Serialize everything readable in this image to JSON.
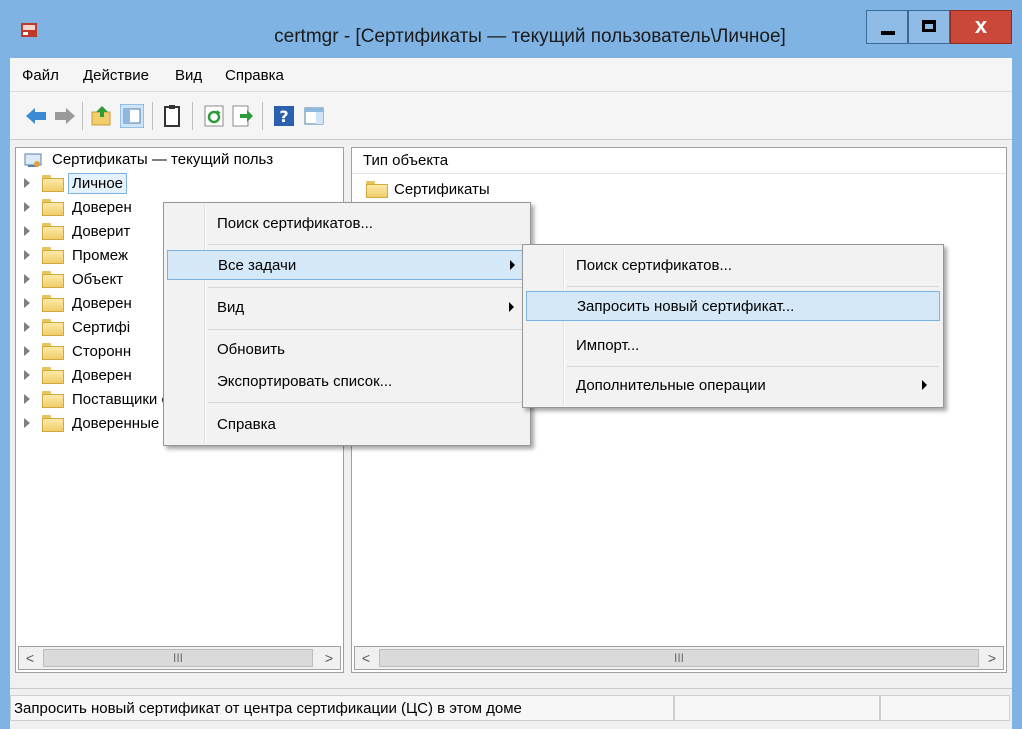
{
  "window": {
    "title": "certmgr - [Сертификаты — текущий пользователь\\Личное]",
    "close_glyph": "x"
  },
  "menubar": {
    "items": [
      "Файл",
      "Действие",
      "Вид",
      "Справка"
    ]
  },
  "toolbar": {
    "buttons": [
      "back-icon",
      "forward-icon",
      "up-folder-icon",
      "show-hide-tree-icon",
      "properties-icon",
      "refresh-icon",
      "export-list-icon",
      "help-icon",
      "action-pane-icon"
    ]
  },
  "tree": {
    "root_label": "Сертификаты — текущий польз",
    "items": [
      {
        "label": "Личное",
        "selected": true
      },
      {
        "label": "Доверен"
      },
      {
        "label": "Доверит"
      },
      {
        "label": "Промеж"
      },
      {
        "label": "Объект"
      },
      {
        "label": "Доверен"
      },
      {
        "label": "Сертифі"
      },
      {
        "label": "Сторонн"
      },
      {
        "label": "Доверен"
      },
      {
        "label": "Поставщики сертификатов"
      },
      {
        "label": "Доверенные корневые серт"
      }
    ]
  },
  "list": {
    "column_header": "Тип объекта",
    "items": [
      "Сертификаты"
    ]
  },
  "context_menu": {
    "items": [
      "Поиск сертификатов...",
      "Все задачи",
      "Вид",
      "Обновить",
      "Экспортировать список...",
      "Справка"
    ],
    "highlighted": "Все задачи"
  },
  "submenu": {
    "items": [
      "Поиск сертификатов...",
      "Запросить новый сертификат...",
      "Импорт...",
      "Дополнительные операции"
    ],
    "highlighted": "Запросить новый сертификат..."
  },
  "scrollbars": {
    "left_arrow": "<",
    "right_arrow": ">",
    "grip": "III"
  },
  "statusbar": {
    "text": "Запросить новый сертификат от центра сертификации (ЦС) в этом доме"
  },
  "colors": {
    "titlebar": "#7fb3e3",
    "close_button": "#c9483a",
    "highlight": "#d5e8f7",
    "highlight_border": "#7cb2e0"
  }
}
